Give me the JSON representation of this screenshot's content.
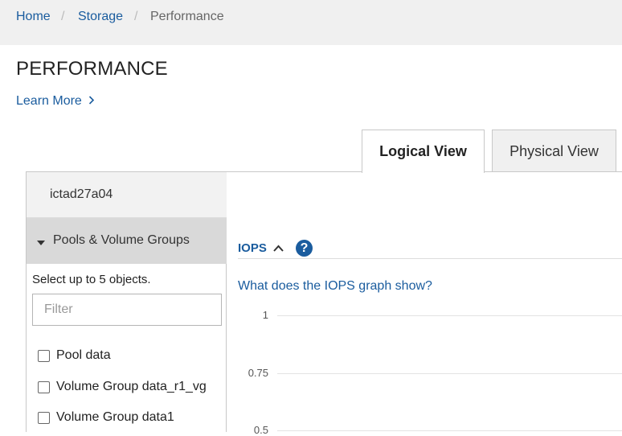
{
  "breadcrumb": {
    "items": [
      {
        "label": "Home"
      },
      {
        "label": "Storage"
      },
      {
        "label": "Performance"
      }
    ],
    "separator": "/"
  },
  "page": {
    "title": "PERFORMANCE",
    "learn_more": "Learn More",
    "learn_more_icon": "chevron-right-icon"
  },
  "tabs": [
    {
      "label": "Logical View",
      "active": true
    },
    {
      "label": "Physical View",
      "active": false
    }
  ],
  "sidebar": {
    "host": "ictad27a04",
    "section": {
      "label": "Pools & Volume Groups",
      "expanded": true,
      "icon": "caret-down-icon"
    },
    "hint": "Select up to 5 objects.",
    "filter": {
      "placeholder": "Filter",
      "value": ""
    },
    "items": [
      {
        "label": "Pool data",
        "checked": false
      },
      {
        "label": "Volume Group data_r1_vg",
        "checked": false
      },
      {
        "label": "Volume Group data1",
        "checked": false
      }
    ]
  },
  "iops": {
    "label": "IOPS",
    "expanded": true,
    "collapse_icon": "chevron-up-icon",
    "help_icon": "help-icon",
    "help_glyph": "?",
    "link": "What does the IOPS graph show?",
    "y_ticks": [
      "1",
      "0.75",
      "0.5"
    ]
  },
  "colors": {
    "link": "#1a5c9e",
    "breadcrumb_bg": "#f0f0f0",
    "section_header_bg": "#d9d9d9"
  }
}
